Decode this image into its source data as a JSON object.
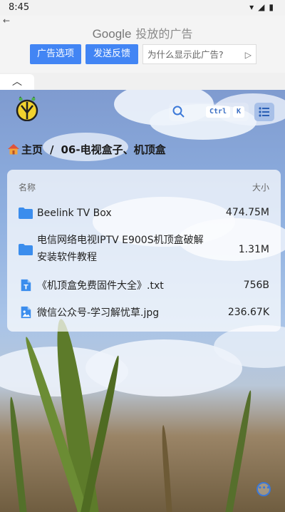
{
  "status_bar": {
    "time": "8:45"
  },
  "ad": {
    "brand": "Google",
    "brand_suffix": "投放的广告",
    "options_label": "广告选项",
    "feedback_label": "发送反馈",
    "why_label": "为什么显示此广告?",
    "why_icon": "play-icon"
  },
  "app": {
    "search_shortcut_ctrl": "Ctrl",
    "search_shortcut_key": "K",
    "breadcrumb": {
      "home": "主页",
      "separator": "/",
      "current": "06-电视盒子、机顶盒"
    },
    "table": {
      "col_name": "名称",
      "col_size": "大小",
      "rows": [
        {
          "icon": "folder-icon",
          "name": "Beelink TV Box",
          "size": "474.75M"
        },
        {
          "icon": "folder-icon",
          "name_line1": "电信网络电视IPTV E900S机顶盒破解",
          "name_line2": "安装软件教程",
          "size": "1.31M"
        },
        {
          "icon": "text-file-icon",
          "name": "《机顶盒免费固件大全》.txt",
          "size": "756B"
        },
        {
          "icon": "image-file-icon",
          "name": "微信公众号-学习解忧草.jpg",
          "size": "236.67K"
        }
      ]
    },
    "accent_color": "#3b78d8"
  }
}
